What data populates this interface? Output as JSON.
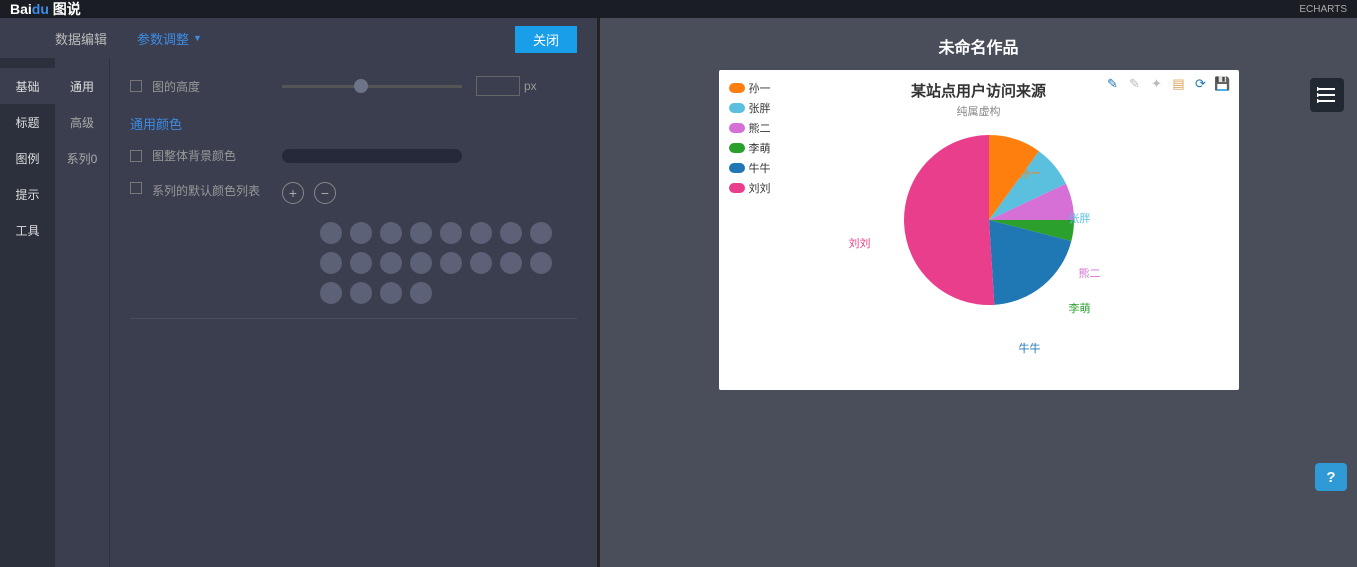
{
  "topbar": {
    "logo_prefix": "Bai",
    "logo_mid": "du",
    "logo_suffix": "图说",
    "right_brand": "ECHARTS"
  },
  "editor": {
    "tab_data": "数据编辑",
    "tab_param": "参数调整",
    "close": "关闭",
    "nav1": [
      "基础",
      "标题",
      "图例",
      "提示",
      "工具"
    ],
    "nav2": [
      "通用",
      "高级",
      "系列0"
    ],
    "row_height": "图的高度",
    "unit_px": "px",
    "section_colors": "通用颜色",
    "row_bgcolor": "图整体背景颜色",
    "row_series_colors": "系列的默认颜色列表"
  },
  "preview": {
    "title": "未命名作品"
  },
  "chart_data": {
    "type": "pie",
    "title": "某站点用户访问来源",
    "subtitle": "纯属虚构",
    "series": [
      {
        "name": "孙一",
        "value": 10,
        "color": "#ff7f0e"
      },
      {
        "name": "张胖",
        "value": 8,
        "color": "#5bc0de"
      },
      {
        "name": "熊二",
        "value": 7,
        "color": "#d66fd6"
      },
      {
        "name": "李萌",
        "value": 4,
        "color": "#2ca02c"
      },
      {
        "name": "牛牛",
        "value": 20,
        "color": "#1f77b4"
      },
      {
        "name": "刘刘",
        "value": 51,
        "color": "#e83e8c"
      }
    ]
  },
  "help": "?"
}
